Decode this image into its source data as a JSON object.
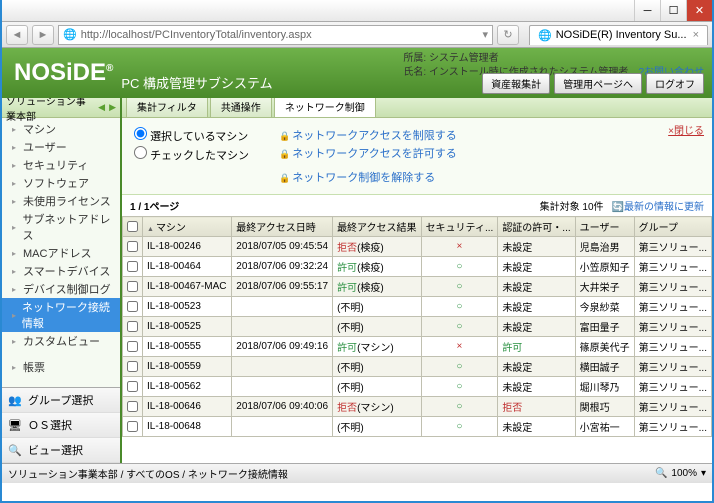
{
  "window": {
    "minimize": "─",
    "maximize": "☐",
    "close": "✕"
  },
  "addr": {
    "url": "http://localhost/PCInventoryTotal/inventory.aspx",
    "tab_title": "NOSiDE(R) Inventory Su...",
    "tab_close": "×"
  },
  "brand": {
    "logo": "NOSiDE",
    "reg": "®",
    "subtitle": "PC 構成管理サブシステム"
  },
  "user": {
    "loc_label": "所属:",
    "loc": "システム管理者",
    "name_label": "氏名:",
    "name": "インストール時に作成されたシステム管理者",
    "help": "お問い合わせ"
  },
  "header_buttons": {
    "b1": "資産報集計",
    "b2": "管理用ページへ",
    "b3": "ログオフ"
  },
  "sidebar": {
    "head": "ソリューション事業本部",
    "items": [
      "マシン",
      "ユーザー",
      "セキュリティ",
      "ソフトウェア",
      "未使用ライセンス",
      "サブネットアドレス",
      "MACアドレス",
      "スマートデバイス",
      "デバイス制御ログ",
      "ネットワーク接続情報",
      "カスタムビュー",
      "",
      "帳票"
    ],
    "selected": 9,
    "foot": [
      {
        "icon": "👥",
        "label": "グループ選択"
      },
      {
        "icon": "🖥",
        "label": "ＯＳ選択"
      },
      {
        "icon": "🔍",
        "label": "ビュー選択"
      }
    ]
  },
  "main_tabs": [
    "集計フィルタ",
    "共通操作",
    "ネットワーク制御"
  ],
  "main_tab_active": 2,
  "filter": {
    "r1": "選択しているマシン",
    "r2": "チェックしたマシン",
    "a1": "ネットワークアクセスを制限する",
    "a2": "ネットワークアクセスを許可する",
    "a3": "ネットワーク制御を解除する",
    "close": "×閉じる"
  },
  "pager": {
    "text": "1 / 1ページ",
    "count": "集計対象 10件",
    "refresh": "最新の情報に更新"
  },
  "columns": [
    "",
    "マシン",
    "最終アクセス日時",
    "最終アクセス結果",
    "セキュリティ...",
    "認証の許可・...",
    "ユーザー",
    "グループ"
  ],
  "rows": [
    {
      "m": "IL-18-00246",
      "dt": "2018/07/05 09:45:54",
      "res": [
        [
          "拒否",
          "red"
        ],
        [
          "(検疫)",
          ""
        ]
      ],
      "sec": "×",
      "auth": "未設定",
      "user": "児島治男",
      "grp": "第三ソリュー..."
    },
    {
      "m": "IL-18-00464",
      "dt": "2018/07/06 09:32:24",
      "res": [
        [
          "許可",
          "green"
        ],
        [
          "(検疫)",
          ""
        ]
      ],
      "sec": "○",
      "auth": "未設定",
      "user": "小笠原知子",
      "grp": "第三ソリュー..."
    },
    {
      "m": "IL-18-00467-MAC",
      "dt": "2018/07/06 09:55:17",
      "res": [
        [
          "許可",
          "green"
        ],
        [
          "(検疫)",
          ""
        ]
      ],
      "sec": "○",
      "auth": "未設定",
      "user": "大井栄子",
      "grp": "第三ソリュー..."
    },
    {
      "m": "IL-18-00523",
      "dt": "",
      "res": [
        [
          "(不明)",
          ""
        ]
      ],
      "sec": "○",
      "auth": "未設定",
      "user": "今泉紗菜",
      "grp": "第三ソリュー..."
    },
    {
      "m": "IL-18-00525",
      "dt": "",
      "res": [
        [
          "(不明)",
          ""
        ]
      ],
      "sec": "○",
      "auth": "未設定",
      "user": "富田量子",
      "grp": "第三ソリュー..."
    },
    {
      "m": "IL-18-00555",
      "dt": "2018/07/06 09:49:16",
      "res": [
        [
          "許可",
          "green"
        ],
        [
          "(マシン)",
          ""
        ]
      ],
      "sec": "×",
      "auth": "許可",
      "ac": "green",
      "user": "篠原美代子",
      "grp": "第三ソリュー..."
    },
    {
      "m": "IL-18-00559",
      "dt": "",
      "res": [
        [
          "(不明)",
          ""
        ]
      ],
      "sec": "○",
      "auth": "未設定",
      "user": "横田誠子",
      "grp": "第三ソリュー..."
    },
    {
      "m": "IL-18-00562",
      "dt": "",
      "res": [
        [
          "(不明)",
          ""
        ]
      ],
      "sec": "○",
      "auth": "未設定",
      "user": "堀川琴乃",
      "grp": "第三ソリュー..."
    },
    {
      "m": "IL-18-00646",
      "dt": "2018/07/06 09:40:06",
      "res": [
        [
          "拒否",
          "red"
        ],
        [
          "(マシン)",
          ""
        ]
      ],
      "sec": "○",
      "auth": "拒否",
      "ac": "red",
      "user": "関根巧",
      "grp": "第三ソリュー..."
    },
    {
      "m": "IL-18-00648",
      "dt": "",
      "res": [
        [
          "(不明)",
          ""
        ]
      ],
      "sec": "○",
      "auth": "未設定",
      "user": "小宮祐一",
      "grp": "第三ソリュー..."
    }
  ],
  "status": {
    "path": "ソリューション事業本部 / すべてのOS / ネットワーク接続情報",
    "zoom": "100%"
  }
}
